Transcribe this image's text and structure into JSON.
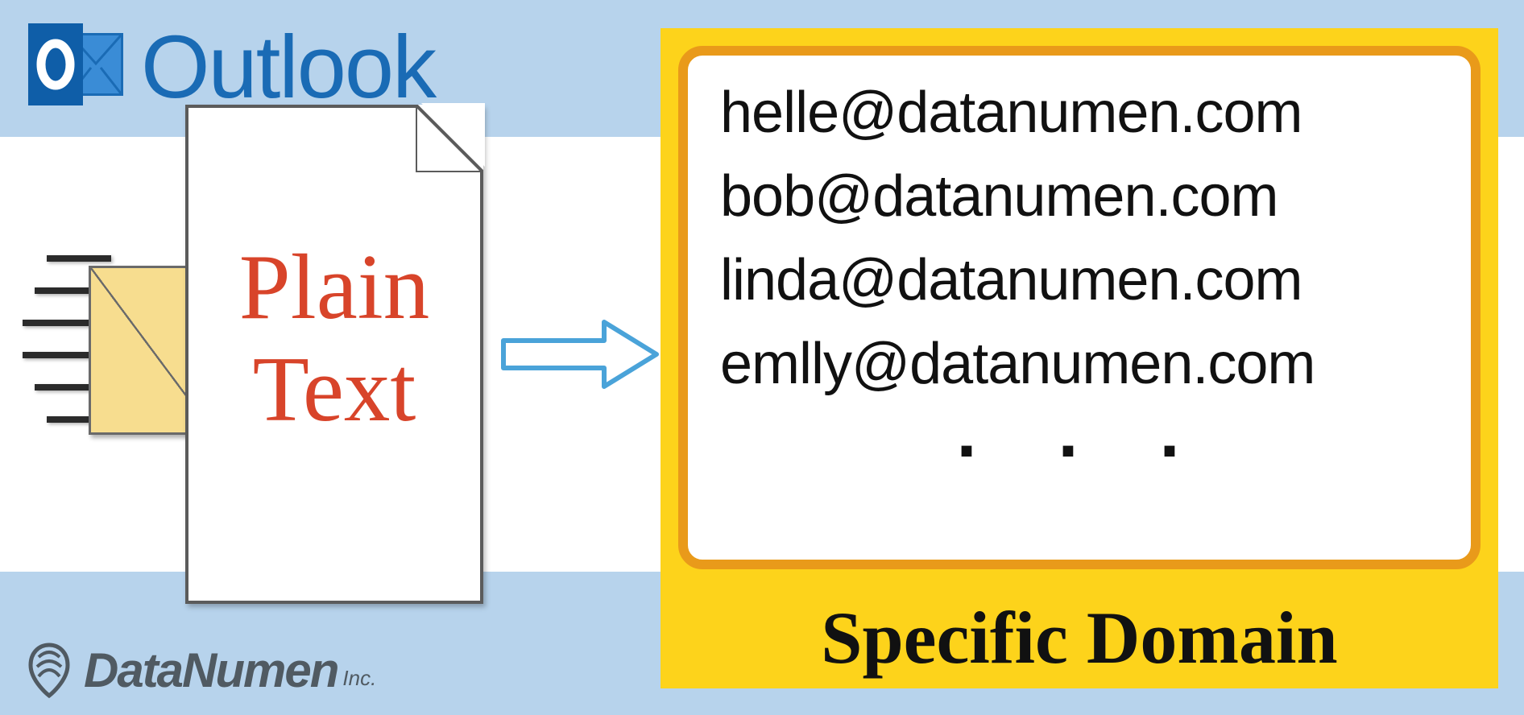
{
  "branding": {
    "app_name": "Outlook",
    "footer_company": "DataNumen",
    "footer_suffix": "Inc."
  },
  "document": {
    "label_line1": "Plain",
    "label_line2": "Text"
  },
  "domain_box": {
    "emails": [
      "helle@datanumen.com",
      "bob@datanumen.com",
      "linda@datanumen.com",
      "emlly@datanumen.com"
    ],
    "ellipsis": ". . .",
    "caption": "Specific Domain"
  },
  "colors": {
    "band": "#b7d3ec",
    "accent_yellow": "#fdd31b",
    "accent_orange": "#e99a1a",
    "text_red": "#d8442a",
    "outlook_blue": "#1a6bb5"
  }
}
